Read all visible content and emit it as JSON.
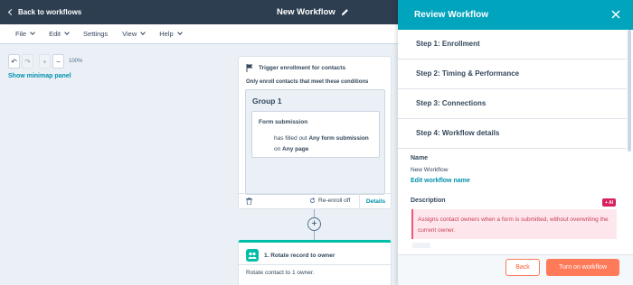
{
  "topbar": {
    "back_label": "Back to workflows",
    "workflow_title": "New Workflow"
  },
  "menu": {
    "items": [
      {
        "label": "File",
        "has_caret": true
      },
      {
        "label": "Edit",
        "has_caret": true
      },
      {
        "label": "Settings",
        "has_caret": false
      },
      {
        "label": "View",
        "has_caret": true
      },
      {
        "label": "Help",
        "has_caret": true
      }
    ]
  },
  "canvas": {
    "zoom_level": "100%",
    "minimap_label": "Show minimap panel",
    "trigger": {
      "title": "Trigger enrollment for contacts",
      "condition_note": "Only enroll contacts that meet these conditions",
      "group_label": "Group 1",
      "filter_title": "Form submission",
      "filter_text_1": "has filled out ",
      "filter_bold_1": "Any form submission",
      "filter_text_2": " on ",
      "filter_bold_2": "Any page",
      "reenroll_label": "Re-enroll off",
      "details_label": "Details"
    },
    "action": {
      "title": "1. Rotate record to owner",
      "description": "Rotate contact to 1 owner."
    }
  },
  "review_panel": {
    "title": "Review Workflow",
    "steps": [
      {
        "label": "Step 1: Enrollment"
      },
      {
        "label": "Step 2: Timing & Performance"
      },
      {
        "label": "Step 3: Connections"
      },
      {
        "label": "Step 4: Workflow details"
      }
    ],
    "name_label": "Name",
    "name_value": "New Workflow",
    "edit_name_link": "Edit workflow name",
    "description_label": "Description",
    "ai_badge": "+ AI",
    "description_value": "Assigns contact owners when a form is submitted, without overwriting the current owner.",
    "back_button": "Back",
    "turn_on_button": "Turn on workflow"
  },
  "colors": {
    "header_dark": "#2d3e50",
    "panel_header": "#00a4bd",
    "accent_orange": "#ff7a59",
    "link_teal": "#0091ae",
    "action_teal": "#00bda5"
  }
}
